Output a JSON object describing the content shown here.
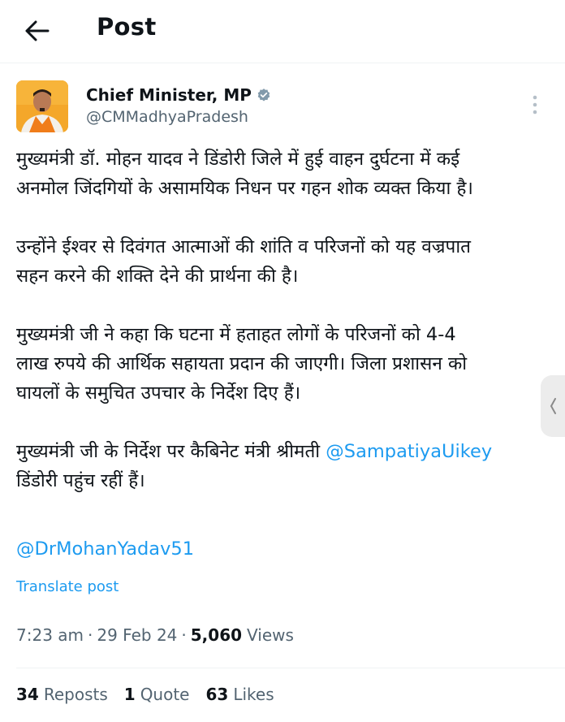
{
  "header": {
    "back_icon": "arrow-left-icon",
    "title": "Post"
  },
  "author": {
    "display_name": "Chief Minister, MP",
    "handle": "@CMMadhyaPradesh",
    "verified_icon": "verified-badge-icon",
    "more_icon": "more-vertical-icon"
  },
  "post": {
    "paragraphs": [
      [
        "मुख्यमंत्री डॉ. मोहन यादव ने डिंडोरी जिले में हुई वाहन दुर्घटना में कई",
        "अनमोल जिंदगियों के असामयिक निधन पर गहन शोक व्यक्त किया है।"
      ],
      [
        "उन्होंने ईश्वर से दिवंगत आत्माओं की शांति व परिजनों को यह वज्रपात",
        "सहन करने की शक्ति देने की प्रार्थना की है।"
      ],
      [
        "मुख्यमंत्री जी ने कहा कि घटना में  हताहत लोगों के परिजनों को 4-4",
        "लाख रुपये की आर्थिक सहायता प्रदान की जाएगी। जिला प्रशासन को",
        "घायलों के समुचित उपचार के निर्देश दिए हैं।"
      ]
    ],
    "last_para_prefix": "मुख्यमंत्री जी के निर्देश पर कैबिनेट मंत्री श्रीमती ",
    "last_para_mention": "@SampatiyaUikey",
    "last_para_suffix": "डिंडोरी पहुंच रहीं हैं।",
    "footer_mention": "@DrMohanYadav51",
    "translate_label": "Translate post"
  },
  "meta": {
    "time": "7:23 am",
    "date": "29 Feb 24",
    "views_count": "5,060",
    "views_label": "Views",
    "separator": "·"
  },
  "stats": {
    "reposts_count": "34",
    "reposts_label": "Reposts",
    "quotes_count": "1",
    "quotes_label": "Quote",
    "likes_count": "63",
    "likes_label": "Likes"
  },
  "colors": {
    "accent": "#1d9bf0",
    "text": "#0f1419",
    "muted": "#536471",
    "avatar_bg": "#f5a623"
  }
}
